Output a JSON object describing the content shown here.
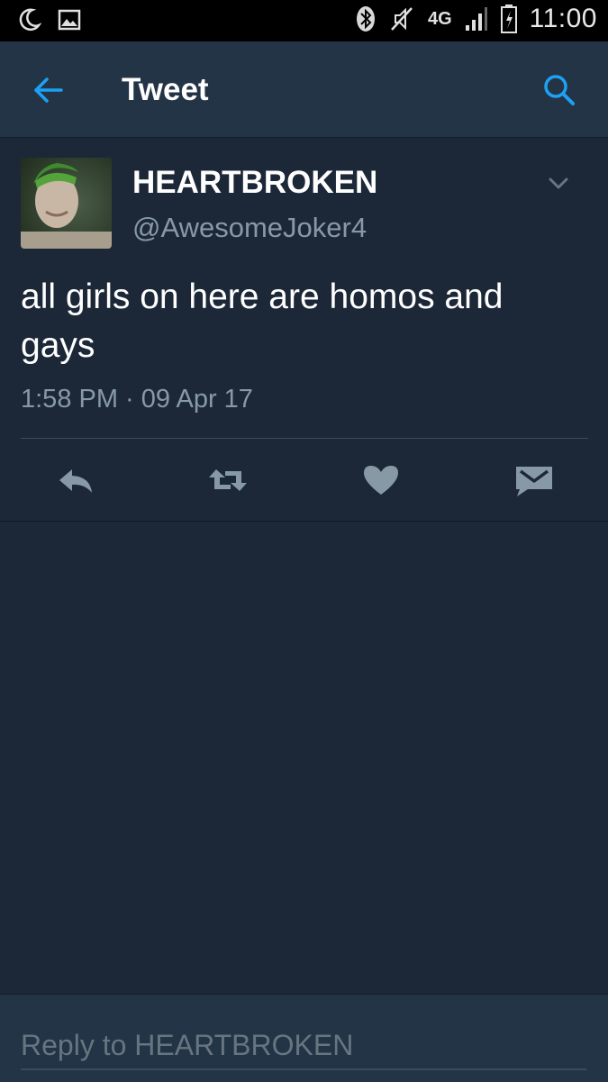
{
  "status_bar": {
    "time": "11:00",
    "network": "4G",
    "icons": [
      "moon-icon",
      "image-icon",
      "bluetooth-icon",
      "mute-icon",
      "signal-icon",
      "battery-icon"
    ]
  },
  "app_bar": {
    "title": "Tweet",
    "back_icon": "back-arrow-icon",
    "search_icon": "search-icon"
  },
  "tweet": {
    "display_name": "HEARTBROKEN",
    "handle": "@AwesomeJoker4",
    "text": "all girls on here are homos and gays",
    "timestamp": "1:58 PM · 09 Apr 17",
    "actions": [
      "reply-icon",
      "retweet-icon",
      "like-icon",
      "direct-message-icon"
    ]
  },
  "reply": {
    "placeholder": "Reply to HEARTBROKEN"
  },
  "colors": {
    "background": "#1c2838",
    "bar": "#243447",
    "accent": "#1da1f2",
    "muted": "#8899a6"
  }
}
